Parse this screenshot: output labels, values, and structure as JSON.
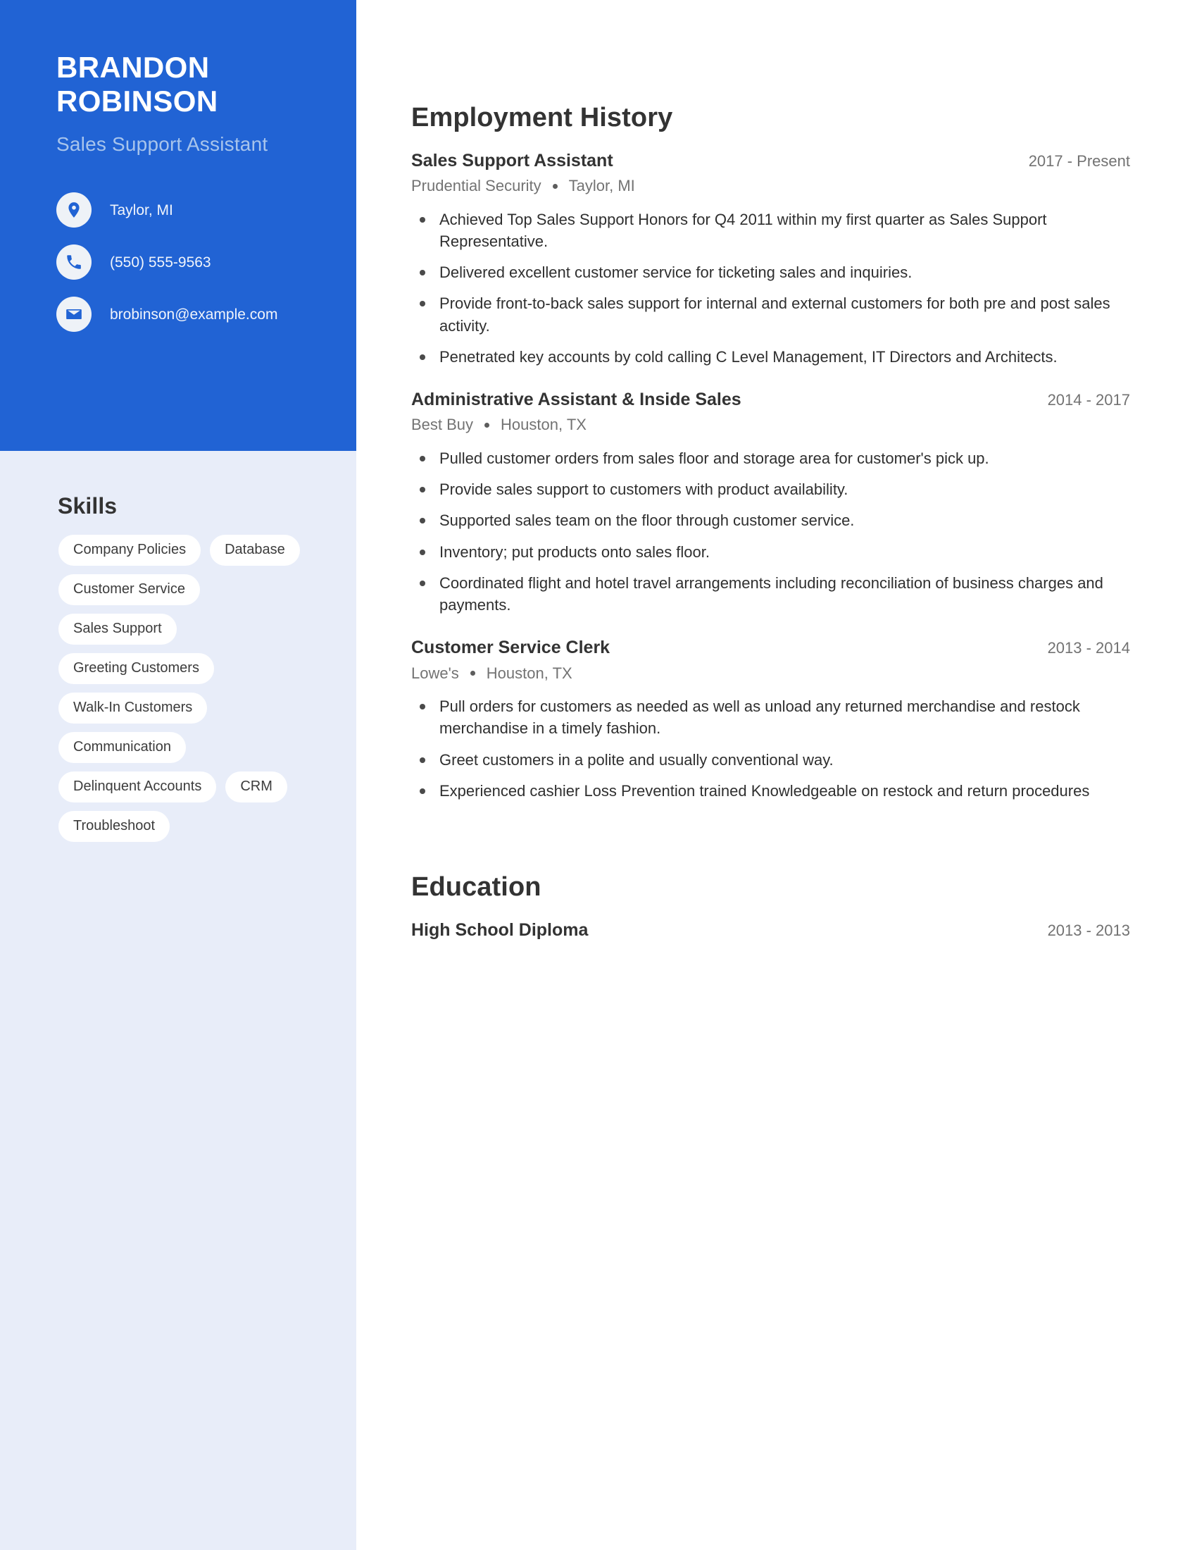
{
  "colors": {
    "header_blue": "#2163d4",
    "sidebar_bg": "#e8edf9",
    "subtitle_blue": "#a7c4ec",
    "pill_bg": "#ffffff",
    "heading_gray": "#333333",
    "muted_gray": "#737373"
  },
  "profile": {
    "first_name": "BRANDON",
    "last_name": "ROBINSON",
    "job_title": "Sales Support Assistant"
  },
  "contact": [
    {
      "icon": "location-pin-icon",
      "value": "Taylor, MI"
    },
    {
      "icon": "phone-icon",
      "value": "(550) 555-9563"
    },
    {
      "icon": "envelope-icon",
      "value": "brobinson@example.com"
    }
  ],
  "skills": {
    "heading": "Skills",
    "items": [
      "Company Policies",
      "Database",
      "Customer Service",
      "Sales Support",
      "Greeting Customers",
      "Walk-In Customers",
      "Communication",
      "Delinquent Accounts",
      "CRM",
      "Troubleshoot"
    ]
  },
  "employment": {
    "heading": "Employment History",
    "entries": [
      {
        "title": "Sales Support Assistant",
        "date": "2017 - Present",
        "company": "Prudential Security",
        "location": "Taylor, MI",
        "bullets": [
          "Achieved Top Sales Support Honors for Q4 2011 within my first quarter as Sales Support Representative.",
          "Delivered excellent customer service for ticketing sales and inquiries.",
          "Provide front-to-back sales support for internal and external customers for both pre and post sales activity.",
          "Penetrated key accounts by cold calling C Level Management, IT Directors and Architects."
        ]
      },
      {
        "title": "Administrative Assistant & Inside Sales",
        "date": "2014 - 2017",
        "company": "Best Buy",
        "location": "Houston, TX",
        "bullets": [
          "Pulled customer orders from sales floor and storage area for customer's pick up.",
          "Provide sales support to customers with product availability.",
          "Supported sales team on the floor through customer service.",
          "Inventory; put products onto sales floor.",
          "Coordinated flight and hotel travel arrangements including reconciliation of business charges and payments."
        ]
      },
      {
        "title": "Customer Service Clerk",
        "date": "2013 - 2014",
        "company": "Lowe's",
        "location": "Houston, TX",
        "bullets": [
          "Pull orders for customers as needed as well as unload any returned merchandise and restock merchandise in a timely fashion.",
          "Greet customers in a polite and usually conventional way.",
          "Experienced cashier Loss Prevention trained Knowledgeable on restock and return procedures"
        ]
      }
    ]
  },
  "education": {
    "heading": "Education",
    "entries": [
      {
        "title": "High School Diploma",
        "date": "2013 - 2013"
      }
    ]
  }
}
